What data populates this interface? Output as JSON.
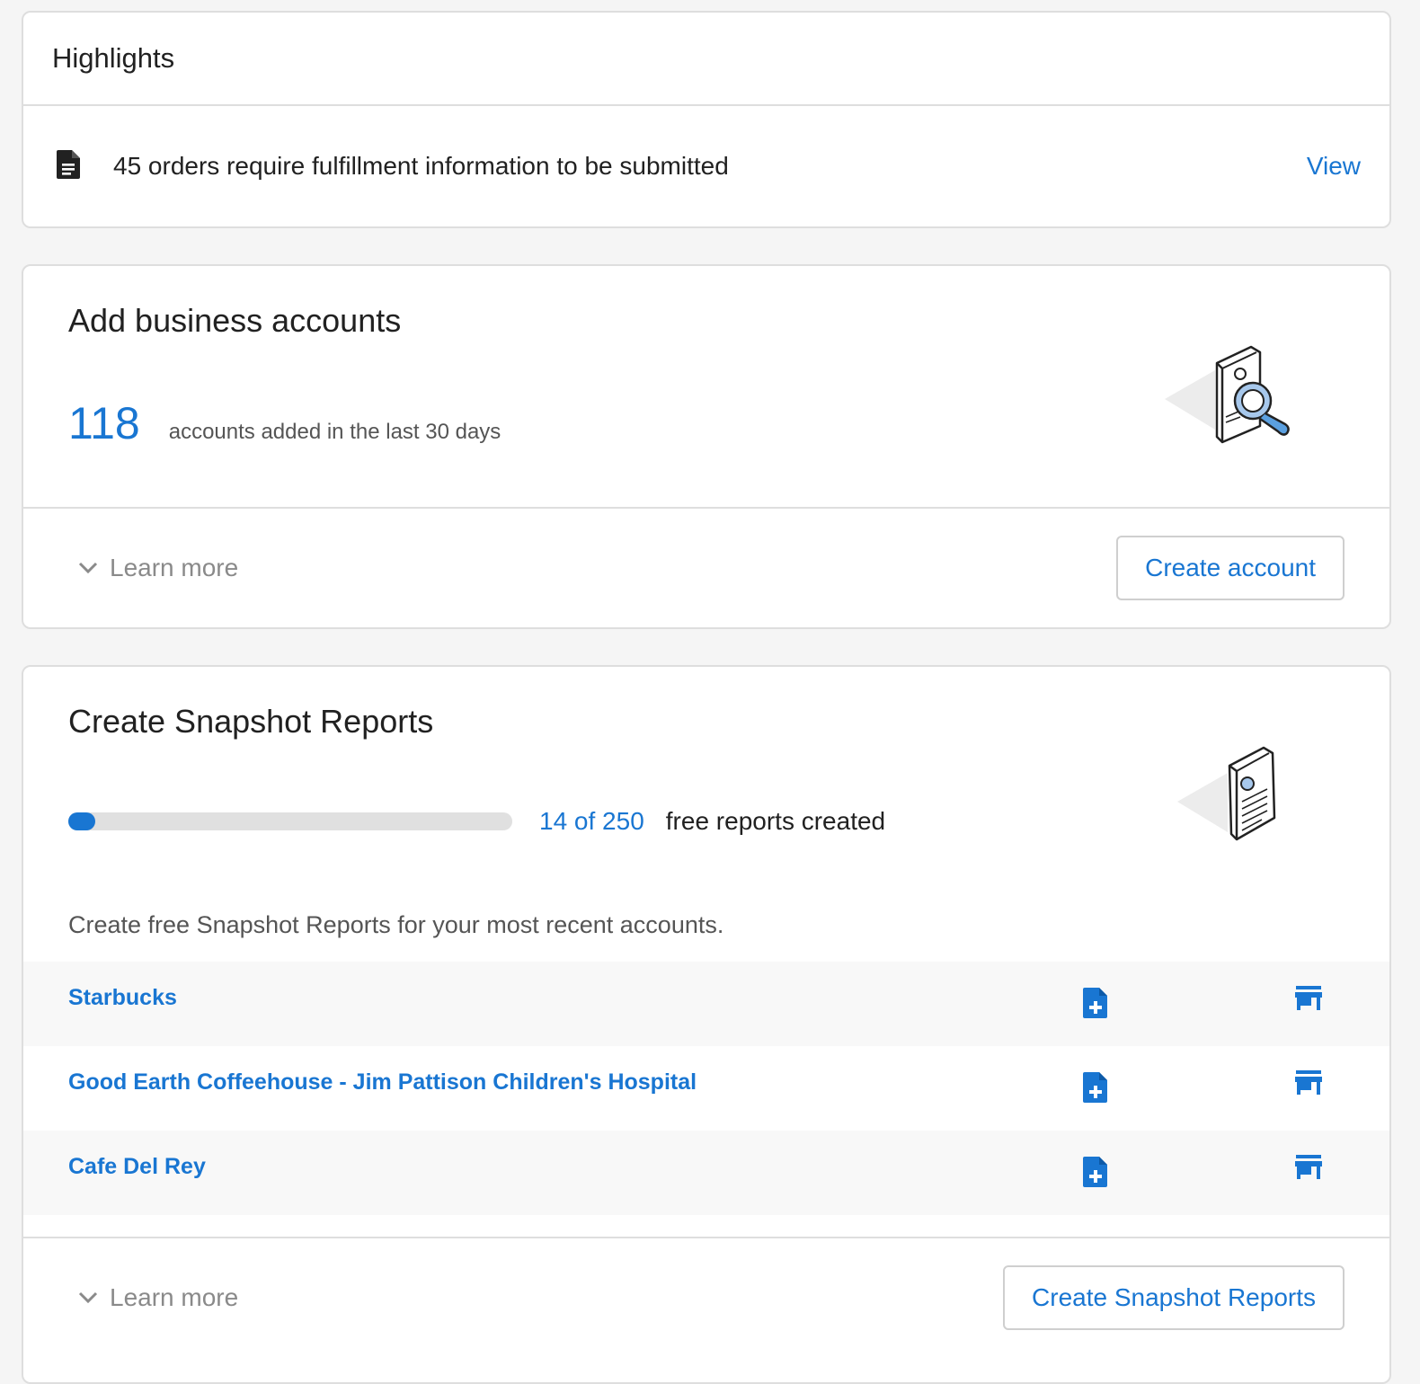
{
  "highlights": {
    "title": "Highlights",
    "item": {
      "icon": "document-icon",
      "message": "45 orders require fulfillment information to be submitted",
      "action": "View"
    }
  },
  "accounts": {
    "title": "Add business accounts",
    "count": "118",
    "count_label": "accounts added in the last 30 days",
    "learn_more": "Learn more",
    "create_button": "Create account",
    "illustration": "account-search-illustration"
  },
  "snapshot": {
    "title": "Create Snapshot Reports",
    "progress": {
      "created": 14,
      "total": 250,
      "fraction": 0.056
    },
    "progress_count": "14 of 250",
    "progress_suffix": "free reports created",
    "description": "Create free Snapshot Reports for your most recent accounts.",
    "accounts": [
      {
        "name": "Starbucks"
      },
      {
        "name": "Good Earth Coffeehouse - Jim Pattison Children's Hospital"
      },
      {
        "name": "Cafe Del Rey"
      }
    ],
    "row_icons": [
      "add-report-icon",
      "store-icon"
    ],
    "learn_more": "Learn more",
    "create_button": "Create Snapshot Reports",
    "illustration": "report-document-illustration"
  },
  "colors": {
    "accent": "#1976d2",
    "border": "#dedede",
    "background": "#f5f5f5"
  }
}
